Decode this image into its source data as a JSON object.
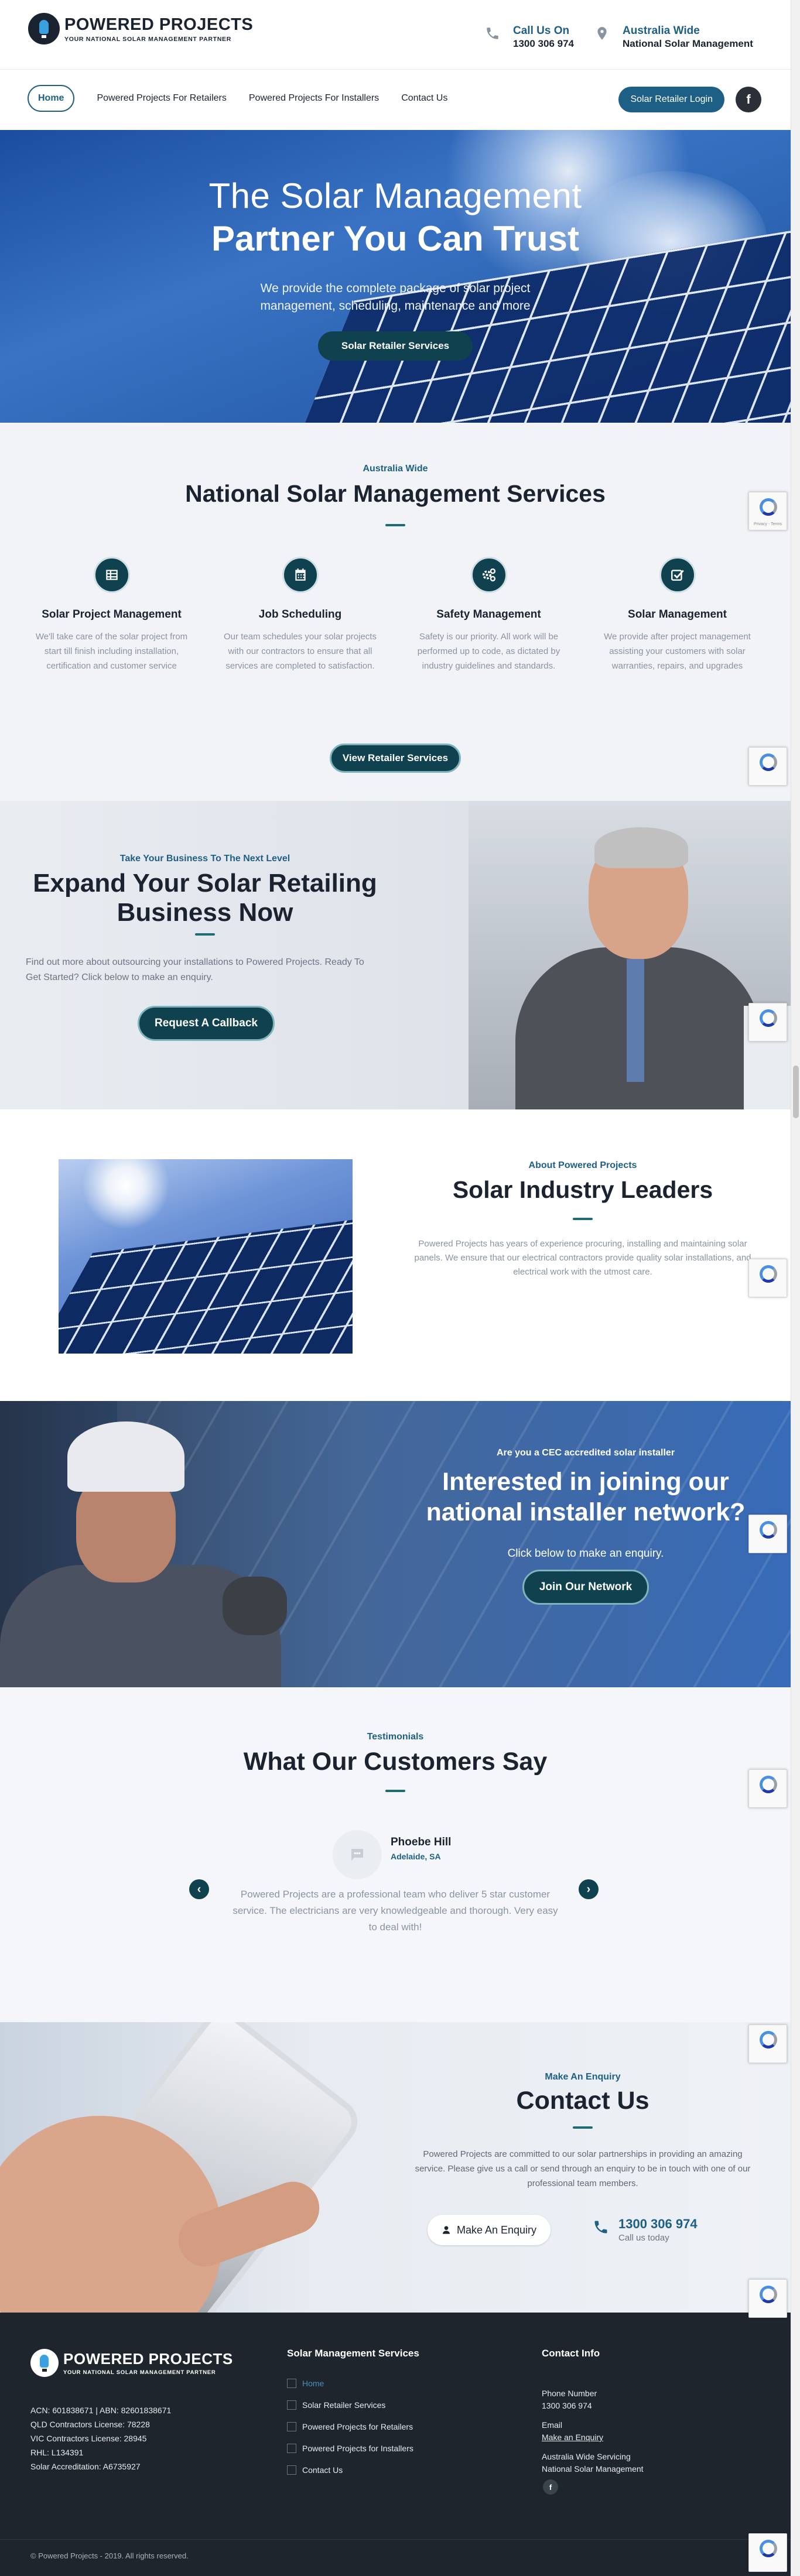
{
  "header": {
    "brand": {
      "title": "POWERED PROJECTS",
      "tagline": "YOUR NATIONAL SOLAR MANAGEMENT PARTNER"
    },
    "call": {
      "label": "Call Us On",
      "value": "1300 306 974",
      "icon": "phone-icon"
    },
    "location": {
      "label": "Australia Wide",
      "value": "National Solar Management",
      "icon": "map-pin-icon"
    },
    "nav": [
      {
        "label": "Home",
        "active": true
      },
      {
        "label": "Powered Projects For Retailers"
      },
      {
        "label": "Powered Projects For Installers"
      },
      {
        "label": "Contact Us"
      }
    ],
    "login_label": "Solar Retailer Login",
    "facebook_glyph": "f"
  },
  "hero": {
    "line1": "The Solar Management",
    "line2": "Partner You Can Trust",
    "paragraph": "We provide the complete package of solar project management, scheduling, maintenance and more",
    "button": "Solar Retailer Services"
  },
  "services": {
    "kicker": "Australia Wide",
    "title": "National Solar Management Services",
    "items": [
      {
        "icon": "project-grid-icon",
        "title": "Solar Project Management",
        "text": "We'll take care of the solar project from start till finish including installation, certification and customer service"
      },
      {
        "icon": "calendar-icon",
        "title": "Job Scheduling",
        "text": "Our team schedules your solar projects with our contractors to ensure that all services are completed to satisfaction."
      },
      {
        "icon": "gears-icon",
        "title": "Safety Management",
        "text": "Safety is our priority. All work will be performed up to code, as dictated by industry guidelines and standards."
      },
      {
        "icon": "checkbox-icon",
        "title": "Solar Management",
        "text": "We provide after project management assisting your customers with solar warranties, repairs, and upgrades"
      }
    ],
    "button": "View Retailer Services"
  },
  "expand": {
    "kicker": "Take Your Business To The Next Level",
    "title": "Expand Your Solar Retailing Business Now",
    "description": "Find out more about outsourcing your installations to Powered Projects. Ready To Get Started? Click below to make an enquiry.",
    "button": "Request A Callback"
  },
  "about": {
    "kicker": "About Powered Projects",
    "title": "Solar Industry Leaders",
    "description": "Powered Projects has years of experience procuring, installing and maintaining solar panels. We ensure that our electrical contractors provide quality solar installations, and electrical work with the utmost care."
  },
  "installer": {
    "kicker": "Are you a CEC accredited solar installer",
    "title": "Interested in joining our national installer network?",
    "subtitle": "Click below to make an enquiry.",
    "button": "Join Our Network"
  },
  "testimonials": {
    "kicker": "Testimonials",
    "title": "What Our Customers Say",
    "name": "Phoebe Hill",
    "location": "Adelaide, SA",
    "quote": "Powered Projects are a professional team who deliver 5 star customer service. The electricians are very knowledgeable and thorough. Very easy to deal with!",
    "prev_glyph": "‹",
    "next_glyph": "›"
  },
  "contact": {
    "kicker": "Make An Enquiry",
    "title": "Contact Us",
    "description": "Powered Projects are committed to our solar partnerships in providing an amazing service. Please give us a call or send through an enquiry to be in touch with one of our professional team members.",
    "button": "Make An Enquiry",
    "phone": "1300 306 974",
    "phone_sub": "Call us today"
  },
  "footer": {
    "brand": {
      "title": "POWERED PROJECTS",
      "tagline": "YOUR NATIONAL SOLAR MANAGEMENT PARTNER"
    },
    "info": [
      "ACN: 601838671 | ABN: 82601838671",
      "QLD Contractors License: 78228",
      "VIC Contractors License: 28945",
      "RHL: L134391",
      "Solar Accreditation: A6735927"
    ],
    "services_title": "Solar Management Services",
    "links": [
      "Home",
      "Solar Retailer Services",
      "Powered Projects for Retailers",
      "Powered Projects for Installers",
      "Contact Us"
    ],
    "contact_title": "Contact Info",
    "phone_label": "Phone Number",
    "phone_value": "1300 306 974",
    "email_label": "Email",
    "email_link": "Make an Enquiry",
    "service_area_1": "Australia Wide Servicing",
    "service_area_2": "National Solar Management",
    "facebook_glyph": "f",
    "copyright": "© Powered Projects - 2019. All rights reserved."
  },
  "recaptcha_label": "Privacy - Terms",
  "colors": {
    "primary": "#1e5f86",
    "dark_teal": "#10414e",
    "footer_bg": "#1e252d"
  }
}
